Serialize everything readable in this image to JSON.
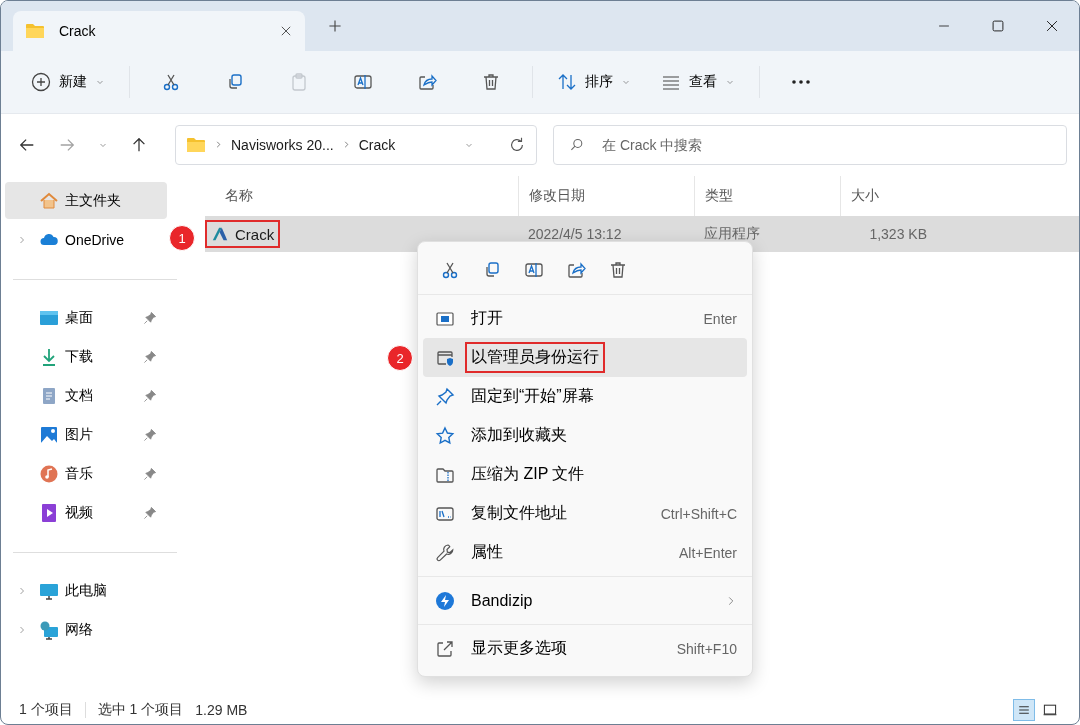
{
  "tabs": [
    {
      "title": "Crack",
      "selected": true
    }
  ],
  "toolbar": {
    "new_label": "新建",
    "sort_label": "排序",
    "view_label": "查看",
    "buttons": [
      {
        "kind": "cut",
        "disabled": false
      },
      {
        "kind": "copy",
        "disabled": false
      },
      {
        "kind": "paste",
        "disabled": true
      },
      {
        "kind": "rename",
        "disabled": false
      },
      {
        "kind": "share",
        "disabled": false
      },
      {
        "kind": "delete",
        "disabled": false
      }
    ]
  },
  "address": {
    "path": [
      "Navisworks 20...",
      "Crack"
    ]
  },
  "search": {
    "placeholder": "在 Crack 中搜索"
  },
  "sidebar": {
    "sections": [
      [
        {
          "label": "主文件夹",
          "kind": "home",
          "selected": true,
          "expandable": false,
          "pinned": false
        },
        {
          "label": "OneDrive",
          "kind": "cloud",
          "selected": false,
          "expandable": true,
          "pinned": false
        }
      ],
      [
        {
          "label": "桌面",
          "kind": "desktop",
          "selected": false,
          "expandable": false,
          "pinned": true
        },
        {
          "label": "下载",
          "kind": "download",
          "selected": false,
          "expandable": false,
          "pinned": true
        },
        {
          "label": "文档",
          "kind": "document",
          "selected": false,
          "expandable": false,
          "pinned": true
        },
        {
          "label": "图片",
          "kind": "pictures",
          "selected": false,
          "expandable": false,
          "pinned": true
        },
        {
          "label": "音乐",
          "kind": "music",
          "selected": false,
          "expandable": false,
          "pinned": true
        },
        {
          "label": "视频",
          "kind": "video",
          "selected": false,
          "expandable": false,
          "pinned": true
        }
      ],
      [
        {
          "label": "此电脑",
          "kind": "pc",
          "selected": false,
          "expandable": true,
          "pinned": false
        },
        {
          "label": "网络",
          "kind": "network",
          "selected": false,
          "expandable": true,
          "pinned": false
        }
      ]
    ]
  },
  "table": {
    "columns": [
      "名称",
      "修改日期",
      "类型",
      "大小"
    ],
    "rows": [
      {
        "name": "Crack",
        "modified": "2022/4/5 13:12",
        "type": "应用程序",
        "size": "1,323 KB",
        "selected": true,
        "annotation": "1"
      }
    ]
  },
  "context_menu": {
    "actions": [
      {
        "kind": "cut"
      },
      {
        "kind": "copy"
      },
      {
        "kind": "rename"
      },
      {
        "kind": "share"
      },
      {
        "kind": "delete"
      }
    ],
    "groups": [
      [
        {
          "label": "打开",
          "shortcut": "Enter",
          "kind": "open",
          "highlighted": false,
          "submenu": false
        },
        {
          "label": "以管理员身份运行",
          "kind": "admin",
          "highlighted": true,
          "submenu": false,
          "annotation": "2"
        },
        {
          "label": "固定到“开始”屏幕",
          "kind": "pin",
          "highlighted": false,
          "submenu": false
        },
        {
          "label": "添加到收藏夹",
          "kind": "star",
          "highlighted": false,
          "submenu": false
        },
        {
          "label": "压缩为 ZIP 文件",
          "kind": "zip",
          "highlighted": false,
          "submenu": false
        },
        {
          "label": "复制文件地址",
          "shortcut": "Ctrl+Shift+C",
          "kind": "path",
          "highlighted": false,
          "submenu": false
        },
        {
          "label": "属性",
          "shortcut": "Alt+Enter",
          "kind": "wrench",
          "highlighted": false,
          "submenu": false
        }
      ],
      [
        {
          "label": "Bandizip",
          "kind": "bandizip",
          "highlighted": false,
          "submenu": true
        }
      ],
      [
        {
          "label": "显示更多选项",
          "shortcut": "Shift+F10",
          "kind": "more",
          "highlighted": false,
          "submenu": false
        }
      ]
    ]
  },
  "status_bar": {
    "count": "1 个项目",
    "selection": "选中 1 个项目",
    "size": "1.29 MB"
  },
  "view_toggle": [
    {
      "kind": "details",
      "selected": true
    },
    {
      "kind": "tiles",
      "selected": false
    }
  ]
}
